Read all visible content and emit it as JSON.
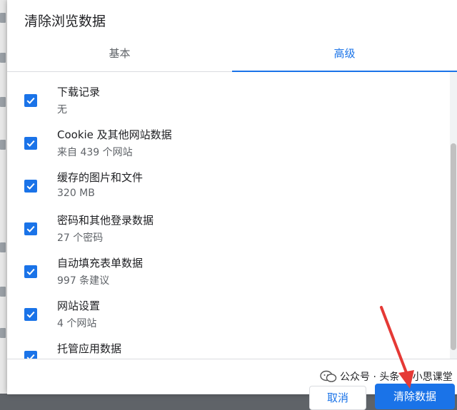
{
  "dialog": {
    "title": "清除浏览数据"
  },
  "tabs": [
    {
      "label": "基本"
    },
    {
      "label": "高级"
    }
  ],
  "items": [
    {
      "title": "下载记录",
      "sub": "无",
      "checked": true
    },
    {
      "title": "Cookie 及其他网站数据",
      "sub": "来自 439 个网站",
      "checked": true
    },
    {
      "title": "缓存的图片和文件",
      "sub": "320 MB",
      "checked": true
    },
    {
      "title": "密码和其他登录数据",
      "sub": "27 个密码",
      "checked": true
    },
    {
      "title": "自动填充表单数据",
      "sub": "997 条建议",
      "checked": true
    },
    {
      "title": "网站设置",
      "sub": "4 个网站",
      "checked": true
    },
    {
      "title": "托管应用数据",
      "sub": "",
      "checked": true
    }
  ],
  "footer": {
    "cancel_label": "取消",
    "clear_label": "清除数据"
  },
  "watermark": {
    "text": "公众号 · 头条 @小思课堂"
  },
  "colors": {
    "accent": "#1a73e8",
    "arrow": "#e53935"
  }
}
